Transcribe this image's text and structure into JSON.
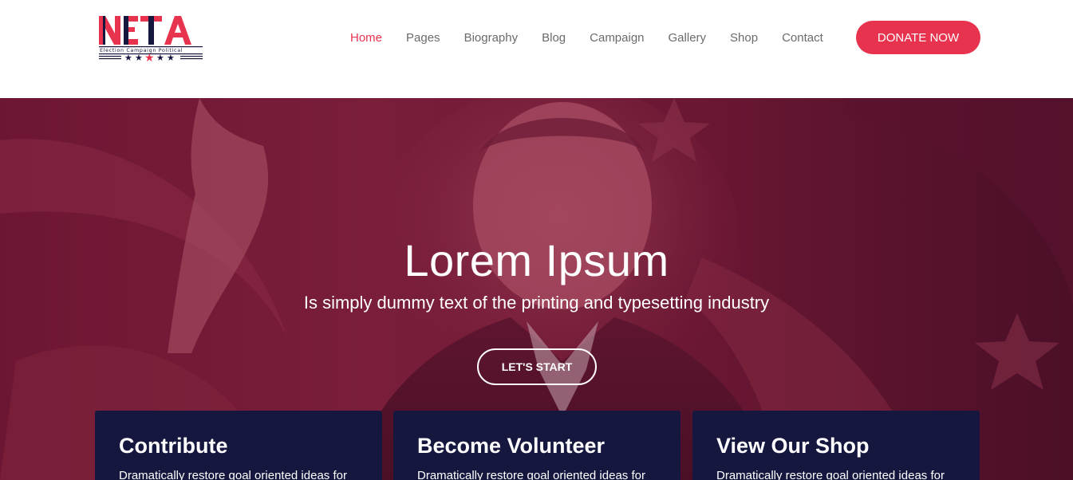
{
  "header": {
    "logo": {
      "text": "NETA",
      "tagline": "Election Campaign Political",
      "brand_color": "#e8334f",
      "dark_color": "#16173f"
    },
    "nav": [
      {
        "label": "Home",
        "active": true
      },
      {
        "label": "Pages",
        "active": false
      },
      {
        "label": "Biography",
        "active": false
      },
      {
        "label": "Blog",
        "active": false
      },
      {
        "label": "Campaign",
        "active": false
      },
      {
        "label": "Gallery",
        "active": false
      },
      {
        "label": "Shop",
        "active": false
      },
      {
        "label": "Contact",
        "active": false
      }
    ],
    "donate_label": "DONATE NOW"
  },
  "hero": {
    "title": "Lorem Ipsum",
    "subtitle": "Is simply dummy text of the printing and typesetting industry",
    "cta_label": "LET'S START",
    "overlay_color": "#6d1633"
  },
  "cards": [
    {
      "title": "Contribute",
      "text": "Dramatically restore goal oriented ideas for"
    },
    {
      "title": "Become Volunteer",
      "text": "Dramatically restore goal oriented ideas for"
    },
    {
      "title": "View Our Shop",
      "text": "Dramatically restore goal oriented ideas for"
    }
  ],
  "colors": {
    "accent": "#e8334f",
    "nav_text": "#6b6b6b",
    "card_bg": "#16173f"
  }
}
